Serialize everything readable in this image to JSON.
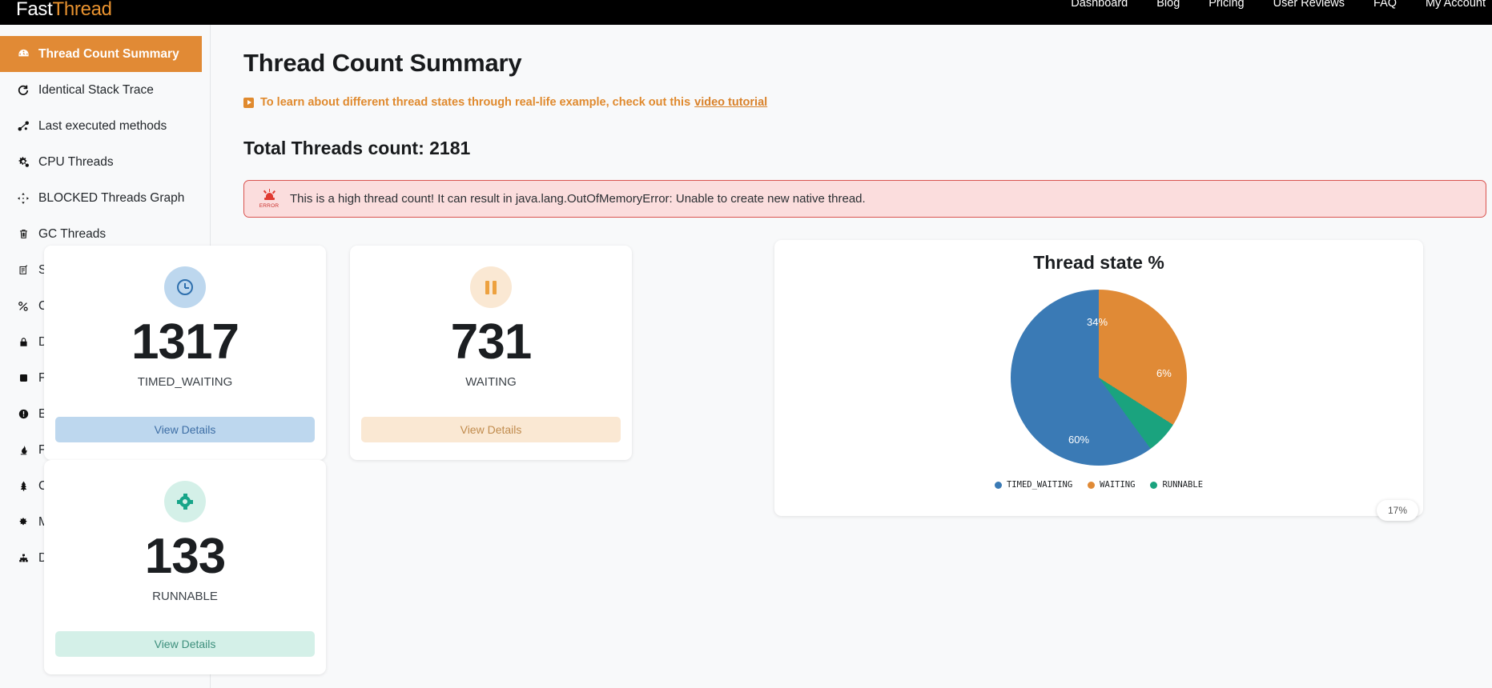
{
  "topbar": {
    "logo_first": "Fast",
    "logo_second": "Thread",
    "nav": [
      {
        "label": "Dashboard"
      },
      {
        "label": "Blog"
      },
      {
        "label": "Pricing"
      },
      {
        "label": "User Reviews"
      },
      {
        "label": "FAQ"
      },
      {
        "label": "My Account"
      }
    ]
  },
  "sidebar": {
    "items": [
      {
        "label": "Thread Count Summary",
        "icon": "gauge-icon",
        "glyph": "⛭",
        "active": true
      },
      {
        "label": "Identical Stack Trace",
        "icon": "refresh-icon",
        "glyph": "↻",
        "active": false
      },
      {
        "label": "Last executed methods",
        "icon": "network-icon",
        "glyph": "⛓",
        "active": false
      },
      {
        "label": "CPU Threads",
        "icon": "gears-icon",
        "glyph": "⚙",
        "active": false
      },
      {
        "label": "BLOCKED Threads Graph",
        "icon": "move-arrows-icon",
        "glyph": "✤",
        "active": false
      },
      {
        "label": "GC Threads",
        "icon": "trash-icon",
        "glyph": "Ὕ1",
        "active": false
      },
      {
        "label": "Stack Length",
        "icon": "stack-list-icon",
        "glyph": "☷",
        "active": false
      },
      {
        "label": "Complex Deadlock",
        "icon": "link-chain-icon",
        "glyph": "%",
        "active": false
      },
      {
        "label": "Dead Lock",
        "icon": "lock-icon",
        "glyph": "ὑ2",
        "active": false
      },
      {
        "label": "Finalizer Thread",
        "icon": "square-icon",
        "glyph": "■",
        "active": false
      },
      {
        "label": "Exception",
        "icon": "exclamation-circle-icon",
        "glyph": "❗",
        "active": false
      },
      {
        "label": "Flame Graph",
        "icon": "flame-icon",
        "glyph": "ὒ5",
        "active": false
      },
      {
        "label": "Call Tree",
        "icon": "tree-icon",
        "glyph": "ἳ2",
        "active": false
      },
      {
        "label": "My Patterns(Beta)",
        "icon": "puzzle-icon",
        "glyph": "❈",
        "active": false
      },
      {
        "label": "Divide & Conquer",
        "icon": "sitemap-icon",
        "glyph": "☳",
        "active": false
      }
    ]
  },
  "main": {
    "page_title": "Thread Count Summary",
    "tutorial_prefix": "To learn about different thread states through real-life example, check out this",
    "tutorial_link": "video tutorial",
    "total_threads_label": "Total Threads count: 2181",
    "alert": {
      "icon_label": "ERROR",
      "message": "This is a high thread count! It can result in java.lang.OutOfMemoryError: Unable to create new native thread."
    },
    "cards": [
      {
        "value": "1317",
        "label": "TIMED_WAITING",
        "button": "View Details",
        "icon": "clock-icon",
        "theme": "blue"
      },
      {
        "value": "731",
        "label": "WAITING",
        "button": "View Details",
        "icon": "pause-icon",
        "theme": "orange"
      },
      {
        "value": "133",
        "label": "RUNNABLE",
        "button": "View Details",
        "icon": "gear-icon",
        "theme": "teal"
      }
    ]
  },
  "chart_data": {
    "type": "pie",
    "title": "Thread state %",
    "categories": [
      "TIMED_WAITING",
      "WAITING",
      "RUNNABLE"
    ],
    "values": [
      60,
      34,
      6
    ],
    "labels": [
      "60%",
      "34%",
      "6%"
    ],
    "counts": [
      1317,
      731,
      133
    ],
    "colors": [
      "#3a7ab5",
      "#e08a36",
      "#1aa37e"
    ],
    "legend_position": "bottom",
    "xlabel": "",
    "ylabel": ""
  },
  "colors": {
    "accent_orange": "#e18a35",
    "blue": "#3a7ab5",
    "teal": "#1aa37e",
    "error_red": "#d9534f"
  },
  "zoom_indicator": "17%"
}
